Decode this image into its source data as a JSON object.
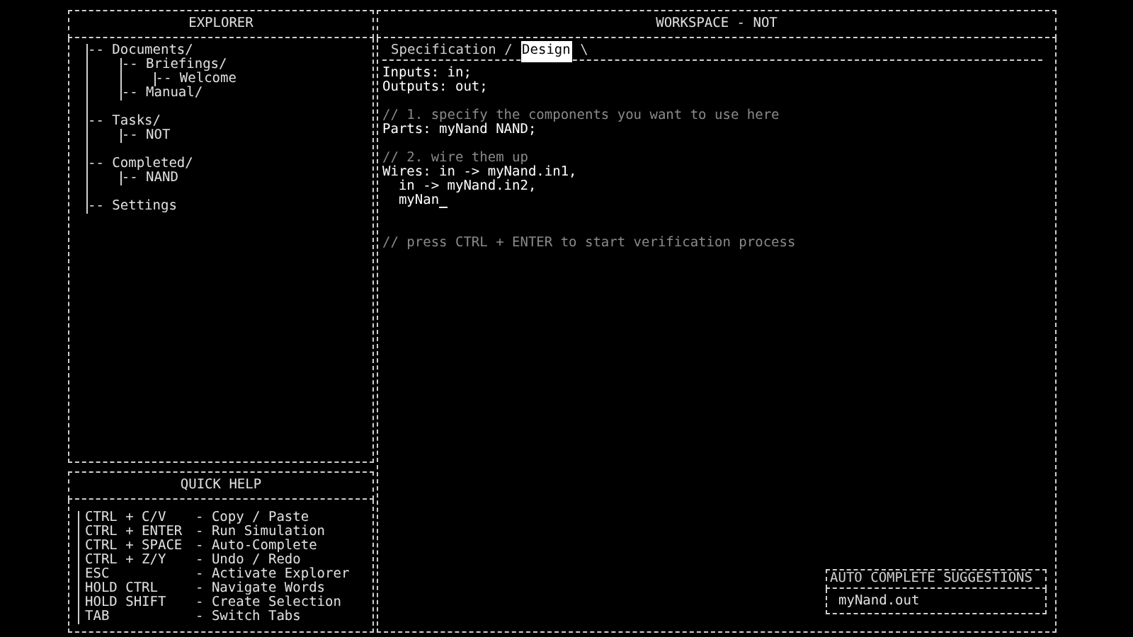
{
  "explorer": {
    "title": "EXPLORER",
    "tree": [
      {
        "label": "-- Documents/",
        "children": [
          {
            "label": "-- Briefings/",
            "children": [
              {
                "label": "-- Welcome"
              }
            ]
          },
          {
            "label": "-- Manual/"
          }
        ]
      },
      {
        "label": "-- Tasks/",
        "children": [
          {
            "label": "-- NOT"
          }
        ]
      },
      {
        "label": "-- Completed/",
        "children": [
          {
            "label": "-- NAND"
          }
        ]
      },
      {
        "label": "-- Settings"
      }
    ]
  },
  "quick_help": {
    "title": "QUICK HELP",
    "rows": [
      {
        "key": "CTRL + C/V",
        "action": "- Copy / Paste"
      },
      {
        "key": "CTRL + ENTER",
        "action": "- Run Simulation"
      },
      {
        "key": "CTRL + SPACE",
        "action": "- Auto-Complete"
      },
      {
        "key": "CTRL + Z/Y",
        "action": "- Undo / Redo"
      },
      {
        "key": "ESC",
        "action": "- Activate Explorer"
      },
      {
        "key": "HOLD CTRL",
        "action": "- Navigate Words"
      },
      {
        "key": "HOLD SHIFT",
        "action": "- Create Selection"
      },
      {
        "key": "TAB",
        "action": "- Switch Tabs"
      }
    ]
  },
  "workspace": {
    "title": "WORKSPACE - NOT",
    "tabs": [
      {
        "label": "Specification",
        "selected": false
      },
      {
        "label": "Design",
        "selected": true
      }
    ],
    "tab_separator": "/",
    "tab_end": "\\",
    "code": [
      {
        "kind": "code",
        "text": "Inputs: in;"
      },
      {
        "kind": "code",
        "text": "Outputs: out;"
      },
      {
        "kind": "blank"
      },
      {
        "kind": "comment",
        "text": "// 1. specify the components you want to use here"
      },
      {
        "kind": "code",
        "text": "Parts: myNand NAND;"
      },
      {
        "kind": "blank"
      },
      {
        "kind": "comment",
        "text": "// 2. wire them up"
      },
      {
        "kind": "code",
        "text": "Wires: in -> myNand.in1,"
      },
      {
        "kind": "code",
        "text": "  in -> myNand.in2,"
      },
      {
        "kind": "cursor",
        "text": "  myNan"
      },
      {
        "kind": "blank"
      },
      {
        "kind": "blank"
      },
      {
        "kind": "comment",
        "text": "// press CTRL + ENTER to start verification process"
      }
    ]
  },
  "autocomplete": {
    "title": "AUTO COMPLETE SUGGESTIONS",
    "items": [
      "myNand.out"
    ]
  }
}
